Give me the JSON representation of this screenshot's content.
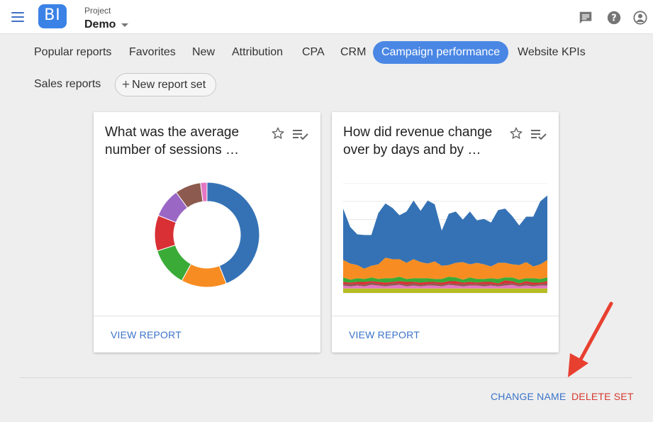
{
  "header": {
    "logo_text": "BI",
    "project_label": "Project",
    "project_value": "Demo",
    "icons": [
      "menu-icon",
      "feedback-icon",
      "help-icon",
      "account-icon"
    ]
  },
  "tabs": [
    {
      "label": "Popular reports",
      "active": false
    },
    {
      "label": "Favorites",
      "active": false
    },
    {
      "label": "New",
      "active": false
    },
    {
      "label": "Attribution",
      "active": false
    },
    {
      "label": "CPA",
      "active": false
    },
    {
      "label": "CRM",
      "active": false
    },
    {
      "label": "Campaign performance",
      "active": true
    },
    {
      "label": "Website KPIs",
      "active": false
    },
    {
      "label": "Sales reports",
      "active": false
    }
  ],
  "new_report_set_label": "New report set",
  "cards": [
    {
      "title_line1": "What was the average",
      "title_line2": "number of sessions …",
      "view_label": "VIEW REPORT",
      "chart_data": {
        "type": "pie",
        "donut": true,
        "slices": [
          {
            "value": 44,
            "color": "#3572b5"
          },
          {
            "value": 14,
            "color": "#f78d22"
          },
          {
            "value": 12,
            "color": "#3aab37"
          },
          {
            "value": 11,
            "color": "#d83035"
          },
          {
            "value": 9,
            "color": "#9a67c5"
          },
          {
            "value": 8,
            "color": "#8c5a4e"
          },
          {
            "value": 2,
            "color": "#e477c3"
          }
        ]
      }
    },
    {
      "title_line1": "How did revenue change",
      "title_line2": "over by days and by …",
      "view_label": "VIEW REPORT",
      "chart_data": {
        "type": "area",
        "stacked": true,
        "grid": true,
        "series": [
          {
            "color": "#b5bd22",
            "values": [
              6,
              6,
              6,
              6,
              6,
              6,
              6,
              6,
              6,
              6,
              6,
              6,
              6,
              6,
              6,
              6,
              6,
              6,
              6,
              6,
              6,
              6,
              6,
              6,
              6,
              6,
              6,
              6,
              6,
              6
            ]
          },
          {
            "color": "#e477c3",
            "values": [
              4,
              3,
              4,
              3,
              5,
              4,
              3,
              4,
              5,
              3,
              4,
              3,
              4,
              4,
              3,
              5,
              4,
              3,
              4,
              4,
              3,
              4,
              3,
              4,
              5,
              3,
              4,
              3,
              4,
              4
            ]
          },
          {
            "color": "#8c5a4e",
            "values": [
              2,
              3,
              2,
              2,
              3,
              2,
              2,
              3,
              2,
              2,
              3,
              2,
              2,
              3,
              2,
              2,
              2,
              3,
              2,
              2,
              3,
              2,
              2,
              3,
              2,
              2,
              3,
              2,
              2,
              3
            ]
          },
          {
            "color": "#d83035",
            "values": [
              3,
              2,
              3,
              4,
              2,
              3,
              3,
              2,
              3,
              4,
              2,
              3,
              3,
              2,
              3,
              3,
              4,
              2,
              3,
              2,
              3,
              3,
              2,
              4,
              3,
              2,
              3,
              3,
              2,
              3
            ]
          },
          {
            "color": "#3aab37",
            "values": [
              6,
              4,
              5,
              4,
              5,
              4,
              6,
              5,
              6,
              4,
              5,
              6,
              5,
              4,
              5,
              6,
              5,
              4,
              6,
              5,
              4,
              5,
              6,
              4,
              5,
              5,
              4,
              6,
              5,
              5
            ]
          },
          {
            "color": "#f78d22",
            "values": [
              24,
              22,
              18,
              14,
              16,
              20,
              28,
              26,
              24,
              22,
              26,
              22,
              20,
              24,
              18,
              16,
              20,
              24,
              18,
              22,
              20,
              16,
              22,
              20,
              18,
              20,
              22,
              16,
              20,
              24
            ]
          },
          {
            "color": "#3572b5",
            "values": [
              70,
              50,
              42,
              46,
              42,
              70,
              74,
              70,
              60,
              70,
              80,
              70,
              86,
              78,
              48,
              70,
              70,
              58,
              72,
              58,
              62,
              60,
              72,
              74,
              66,
              54,
              62,
              68,
              86,
              88
            ]
          }
        ]
      }
    }
  ],
  "footer": {
    "change_name": "CHANGE NAME",
    "delete_set": "DELETE SET"
  },
  "colors": {
    "accent": "#4a87e4",
    "link": "#3b73c8",
    "danger": "#d43a2f",
    "arrow": "#e84030"
  }
}
